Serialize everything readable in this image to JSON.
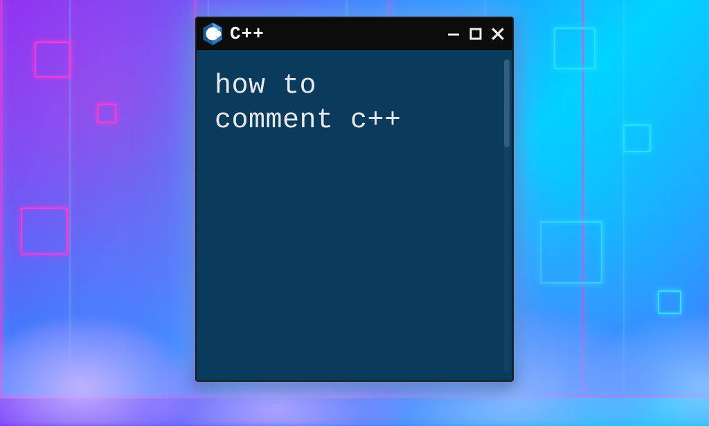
{
  "window": {
    "title": "C++",
    "content": "how to\ncomment c++",
    "logo_label": "C++"
  },
  "controls": {
    "minimize": "minimize",
    "maximize": "maximize",
    "close": "close"
  },
  "colors": {
    "window_bg": "#0a3a5c",
    "titlebar_bg": "#0c0c0c",
    "text": "#e8e8e8",
    "glow": "#78b4ff"
  }
}
